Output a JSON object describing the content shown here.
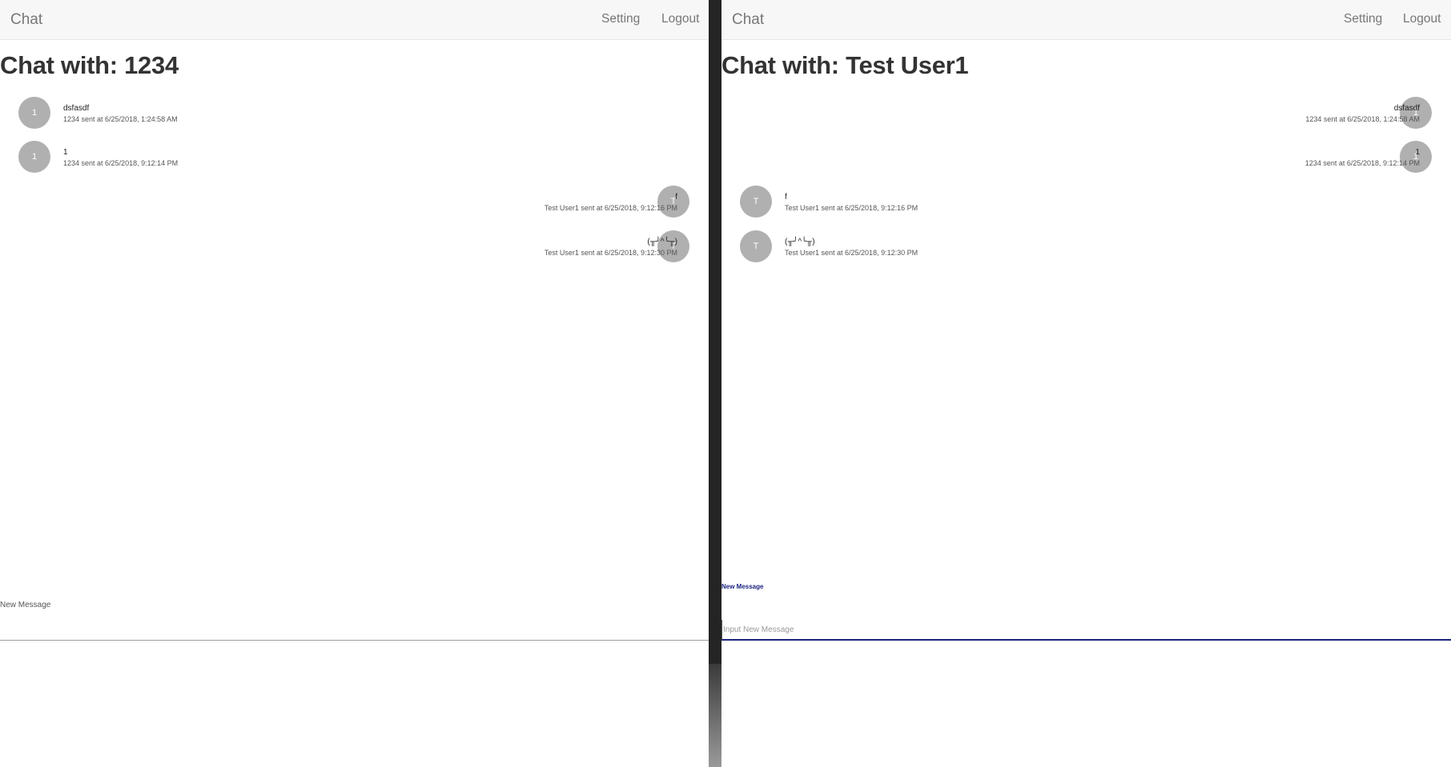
{
  "windows": [
    {
      "brand": "Chat",
      "nav": {
        "setting": "Setting",
        "logout": "Logout"
      },
      "title": "Chat with: 1234",
      "messages": [
        {
          "side": "left",
          "avatar": "1",
          "text": "dsfasdf",
          "meta": "1234 sent at 6/25/2018, 1:24:58 AM"
        },
        {
          "side": "left",
          "avatar": "1",
          "text": "1",
          "meta": "1234 sent at 6/25/2018, 9:12:14 PM"
        },
        {
          "side": "right",
          "avatar": "T",
          "text": "f",
          "meta": "Test User1 sent at 6/25/2018, 9:12:16 PM"
        },
        {
          "side": "right",
          "avatar": "T",
          "text": "(╥╯^╰╥)",
          "meta": "Test User1 sent at 6/25/2018, 9:12:30 PM"
        }
      ],
      "new_message": {
        "label": "New Message",
        "placeholder": "",
        "value": ""
      }
    },
    {
      "brand": "Chat",
      "nav": {
        "setting": "Setting",
        "logout": "Logout"
      },
      "title": "Chat with: Test User1",
      "messages": [
        {
          "side": "right",
          "avatar": "1",
          "text": "dsfasdf",
          "meta": "1234 sent at 6/25/2018, 1:24:58 AM"
        },
        {
          "side": "right",
          "avatar": "1",
          "text": "1",
          "meta": "1234 sent at 6/25/2018, 9:12:14 PM"
        },
        {
          "side": "left",
          "avatar": "T",
          "text": "f",
          "meta": "Test User1 sent at 6/25/2018, 9:12:16 PM"
        },
        {
          "side": "left",
          "avatar": "T",
          "text": "(╥╯^╰╥)",
          "meta": "Test User1 sent at 6/25/2018, 9:12:30 PM"
        }
      ],
      "new_message": {
        "label": "New Message",
        "placeholder": "Input New Message",
        "value": ""
      }
    }
  ],
  "colors": {
    "navbar_bg": "#f7f7f7",
    "avatar_bg": "#b0b0b0",
    "focus_accent": "#1a237e",
    "divider": "#242424"
  }
}
